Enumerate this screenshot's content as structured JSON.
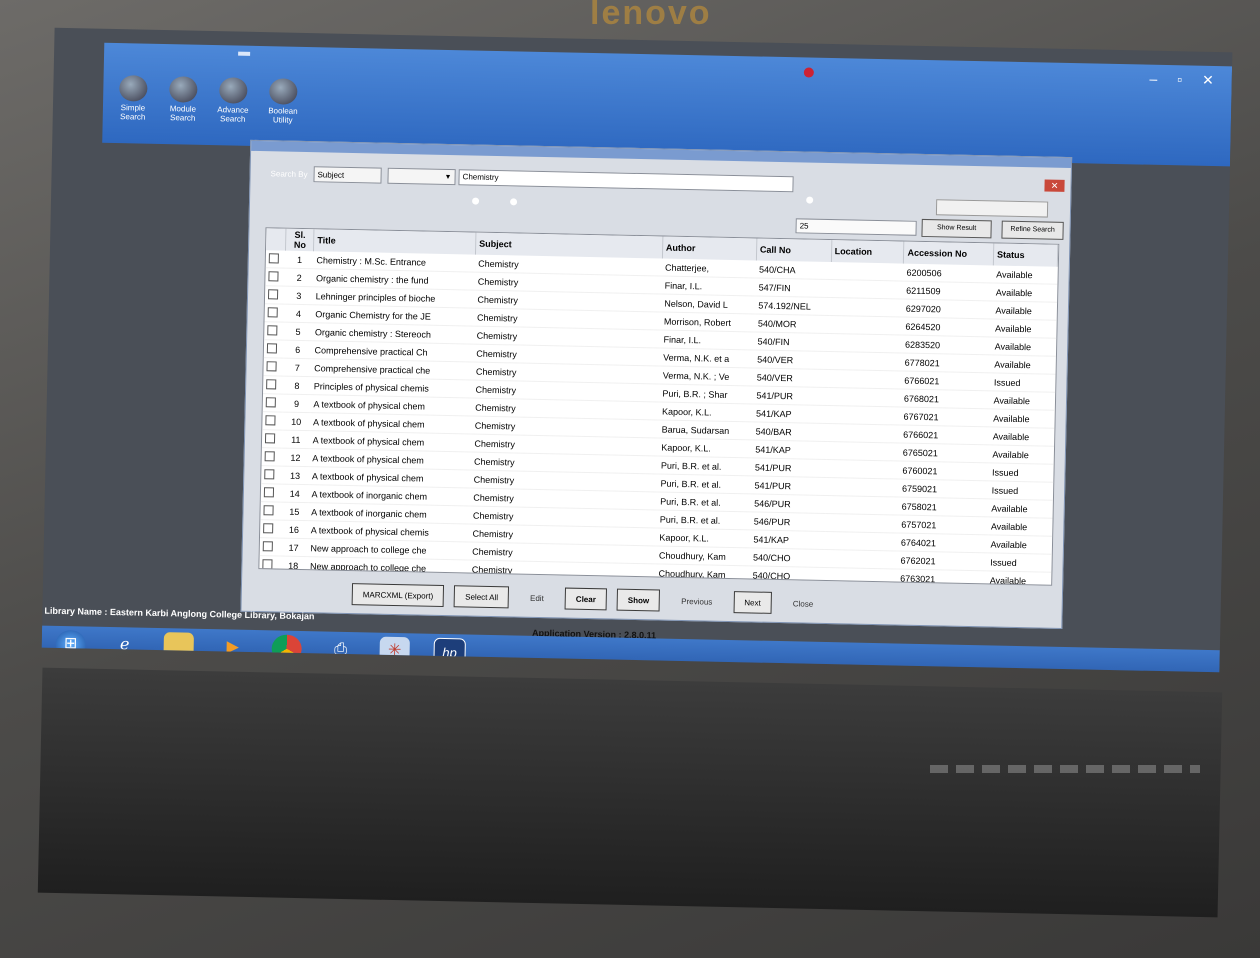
{
  "monitor": {
    "brand": "lenovo"
  },
  "ribbon": {
    "tabs": [
      "",
      "",
      "",
      "",
      "",
      "",
      "",
      ""
    ],
    "active_tab": 5,
    "buttons": [
      {
        "label": "Simple Search",
        "icon": "search-icon"
      },
      {
        "label": "Module Search",
        "icon": "module-icon"
      },
      {
        "label": "Advance Search",
        "icon": "advance-icon"
      },
      {
        "label": "Boolean Utility",
        "icon": "boolean-icon"
      }
    ]
  },
  "dialog": {
    "search_by_label": "Search By",
    "field_select": "Subject",
    "search_value": "Chemistry",
    "page_size": "25",
    "show_result": "Show Result",
    "refine": "Refine Search",
    "columns": {
      "sl": "Sl. No",
      "title": "Title",
      "subject": "Subject",
      "author": "Author",
      "call_no": "Call No",
      "location": "Location",
      "accession": "Accession No",
      "status": "Status"
    },
    "rows": [
      {
        "sl": "1",
        "title": "Chemistry : M.Sc. Entrance",
        "subject": "Chemistry",
        "author": "Chatterjee,",
        "call": "540/CHA",
        "acc": "6200506",
        "status": "Available"
      },
      {
        "sl": "2",
        "title": "Organic chemistry : the fund",
        "subject": "Chemistry",
        "author": "Finar, I.L.",
        "call": "547/FIN",
        "acc": "6211509",
        "status": "Available"
      },
      {
        "sl": "3",
        "title": "Lehninger principles of bioche",
        "subject": "Chemistry",
        "author": "Nelson, David L",
        "call": "574.192/NEL",
        "acc": "6297020",
        "status": "Available"
      },
      {
        "sl": "4",
        "title": "Organic Chemistry for the JE",
        "subject": "Chemistry",
        "author": "Morrison, Robert",
        "call": "540/MOR",
        "acc": "6264520",
        "status": "Available"
      },
      {
        "sl": "5",
        "title": "Organic chemistry : Stereoch",
        "subject": "Chemistry",
        "author": "Finar, I.L.",
        "call": "540/FIN",
        "acc": "6283520",
        "status": "Available"
      },
      {
        "sl": "6",
        "title": "Comprehensive practical Ch",
        "subject": "Chemistry",
        "author": "Verma, N.K. et a",
        "call": "540/VER",
        "acc": "6778021",
        "status": "Available"
      },
      {
        "sl": "7",
        "title": "Comprehensive practical che",
        "subject": "Chemistry",
        "author": "Verma, N.K. ; Ve",
        "call": "540/VER",
        "acc": "6766021",
        "status": "Issued"
      },
      {
        "sl": "8",
        "title": "Principles of physical chemis",
        "subject": "Chemistry",
        "author": "Puri, B.R. ; Shar",
        "call": "541/PUR",
        "acc": "6768021",
        "status": "Available"
      },
      {
        "sl": "9",
        "title": "A textbook of physical chem",
        "subject": "Chemistry",
        "author": "Kapoor, K.L.",
        "call": "541/KAP",
        "acc": "6767021",
        "status": "Available"
      },
      {
        "sl": "10",
        "title": "A textbook of physical chem",
        "subject": "Chemistry",
        "author": "Barua, Sudarsan",
        "call": "540/BAR",
        "acc": "6766021",
        "status": "Available"
      },
      {
        "sl": "11",
        "title": "A textbook of physical chem",
        "subject": "Chemistry",
        "author": "Kapoor, K.L.",
        "call": "541/KAP",
        "acc": "6765021",
        "status": "Available"
      },
      {
        "sl": "12",
        "title": "A textbook of physical chem",
        "subject": "Chemistry",
        "author": "Puri, B.R. et al.",
        "call": "541/PUR",
        "acc": "6760021",
        "status": "Issued"
      },
      {
        "sl": "13",
        "title": "A textbook of physical chem",
        "subject": "Chemistry",
        "author": "Puri, B.R. et al.",
        "call": "541/PUR",
        "acc": "6759021",
        "status": "Issued"
      },
      {
        "sl": "14",
        "title": "A textbook of inorganic chem",
        "subject": "Chemistry",
        "author": "Puri, B.R. et al.",
        "call": "546/PUR",
        "acc": "6758021",
        "status": "Available"
      },
      {
        "sl": "15",
        "title": "A textbook of inorganic chem",
        "subject": "Chemistry",
        "author": "Puri, B.R. et al.",
        "call": "546/PUR",
        "acc": "6757021",
        "status": "Available"
      },
      {
        "sl": "16",
        "title": "A textbook of physical chemis",
        "subject": "Chemistry",
        "author": "Kapoor, K.L.",
        "call": "541/KAP",
        "acc": "6764021",
        "status": "Available"
      },
      {
        "sl": "17",
        "title": "New approach to college che",
        "subject": "Chemistry",
        "author": "Choudhury, Kam",
        "call": "540/CHO",
        "acc": "6762021",
        "status": "Issued"
      },
      {
        "sl": "18",
        "title": "New approach to college che",
        "subject": "Chemistry",
        "author": "Choudhury, Kam",
        "call": "540/CHO",
        "acc": "6763021",
        "status": "Available"
      }
    ],
    "buttons": {
      "marc": "MARCXML (Export)",
      "select_all": "Select All",
      "edit": "Edit",
      "clear": "Clear",
      "show": "Show",
      "previous": "Previous",
      "next": "Next",
      "close": "Close"
    }
  },
  "status": {
    "library_name": "Library Name : Eastern Karbi Anglong College Library, Bokajan",
    "app_version": "Application Version : 2.8.0.11"
  },
  "taskbar": {
    "icons": [
      "start-icon",
      "ie-icon",
      "explorer-icon",
      "media-icon",
      "chrome-icon",
      "scanner-icon",
      "app-icon",
      "hp-icon"
    ]
  }
}
